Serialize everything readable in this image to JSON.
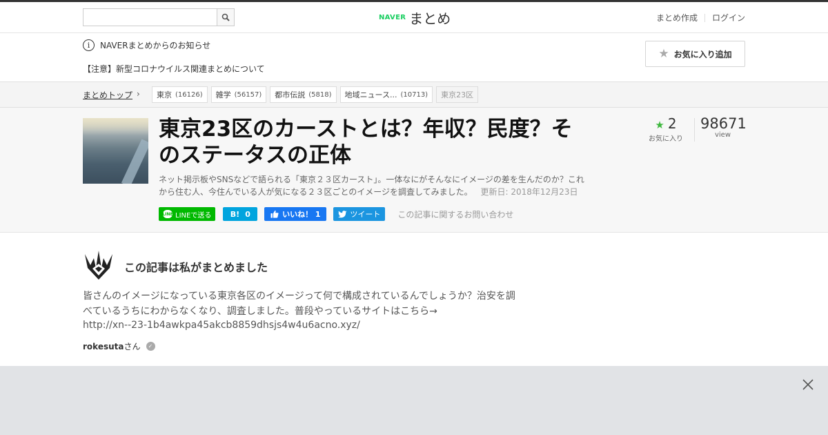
{
  "header": {
    "search_placeholder": "",
    "logo_naver": "NAVER",
    "logo_matome": "まとめ",
    "create_link": "まとめ作成",
    "login_link": "ログイン"
  },
  "notices": {
    "info": "NAVERまとめからのお知らせ",
    "covid": "【注意】新型コロナウイルス関連まとめについて"
  },
  "breadcrumb": {
    "top": "まとめトップ",
    "arrow": "›",
    "tags": [
      {
        "label": "東京",
        "count": "(16126)"
      },
      {
        "label": "雑学",
        "count": "(56157)"
      },
      {
        "label": "都市伝説",
        "count": "(5818)"
      },
      {
        "label": "地域ニュース...",
        "count": "(10713)"
      }
    ],
    "current": "東京23区"
  },
  "article": {
    "title": "東京23区のカーストとは？年収？民度？そのステータスの正体",
    "description": "ネット掲示板やSNSなどで語られる「東京２３区カースト」。一体なにがそんなにイメージの差を生んだのか？これから住む人、今住んでいる人が気になる２３区ごとのイメージを調査してみました。",
    "updated": "更新日: 2018年12月23日",
    "favorites": "2",
    "favorites_label": "お気に入り",
    "views": "98671",
    "views_label": "view",
    "fav_button": "お気に入り追加"
  },
  "share": {
    "line_icon": "LINE",
    "line": "LINEで送る",
    "hatena_icon": "B!",
    "hatena_count": "0",
    "fb": "いいね！ 1",
    "tweet": "ツイート",
    "contact": "この記事に関するお問い合わせ"
  },
  "author": {
    "heading": "この記事は私がまとめました",
    "bio": "皆さんのイメージになっている東京各区のイメージって何で構成されているんでしょうか？治安を調べているうちにわからなくなり、調査しました。普段やっているサイトはこちら→",
    "url": "http://xn--23-1b4awkpa45akcb8859dhsjs4w4u6acno.xyz/",
    "name": "rokesuta",
    "suffix": "さん"
  }
}
